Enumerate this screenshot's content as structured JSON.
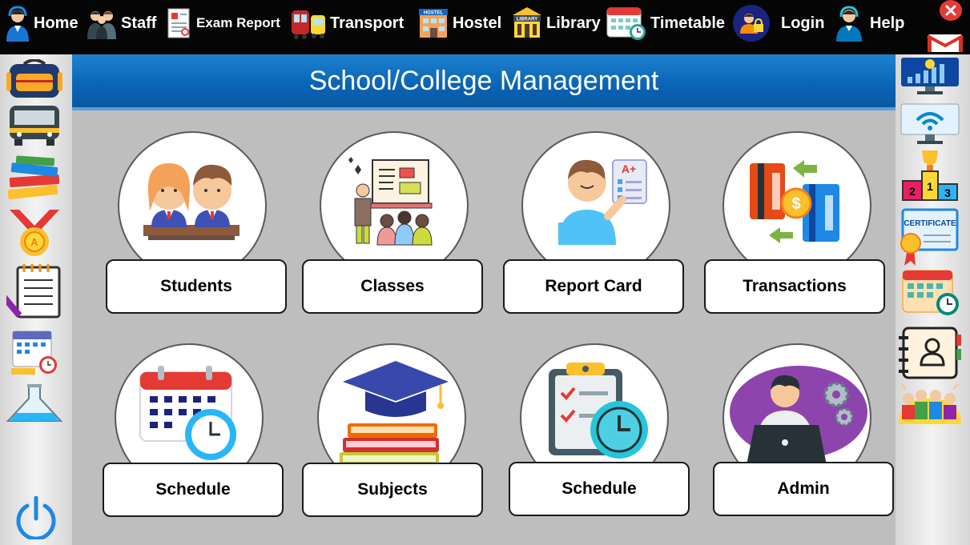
{
  "nav": {
    "home": "Home",
    "staff": "Staff",
    "exam_report": "Exam Report",
    "transport": "Transport",
    "hostel": "Hostel",
    "library": "Library",
    "timetable": "Timetable",
    "login": "Login",
    "help": "Help",
    "hostel_sign": "HOSTEL",
    "library_sign": "LIBRARY"
  },
  "header": {
    "title": "School/College Management"
  },
  "tiles": {
    "students": "Students",
    "classes": "Classes",
    "report_card": "Report Card",
    "transactions": "Transactions",
    "schedule_1": "Schedule",
    "subjects": "Subjects",
    "schedule_2": "Schedule",
    "admin": "Admin"
  },
  "report_grade": "A+",
  "certificate_text": "CERTIFICATE",
  "podium": [
    "2",
    "1",
    "3"
  ],
  "colors": {
    "header_blue": "#0a63b4",
    "main_bg": "#bebebe",
    "topbar": "#050505",
    "close_red": "#e53935"
  },
  "icons": {
    "left_sidebar": [
      "backpack-icon",
      "school-bus-icon",
      "books-icon",
      "medal-icon",
      "notepad-icon",
      "calendar-icon",
      "flask-icon",
      "power-icon"
    ],
    "right_sidebar": [
      "analytics-monitor-icon",
      "wifi-monitor-icon",
      "podium-icon",
      "certificate-icon",
      "calendar-clock-icon",
      "contact-book-icon",
      "group-icon"
    ]
  }
}
